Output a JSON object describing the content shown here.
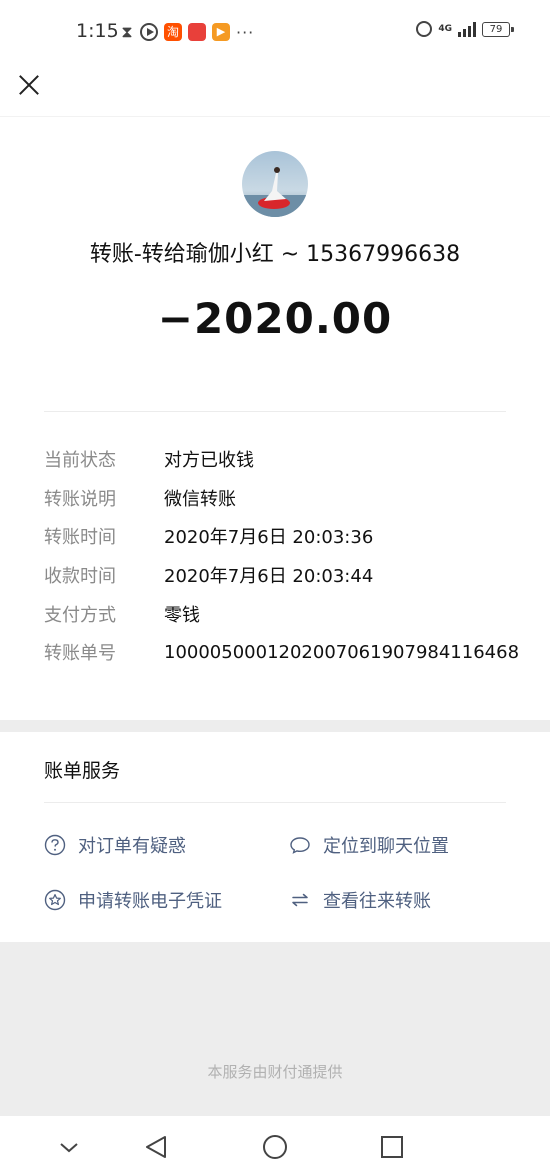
{
  "status_bar": {
    "time": "1:15",
    "tao_label": "淘",
    "network": "4G",
    "battery": "79",
    "more": "···"
  },
  "receipt": {
    "title": "转账-转给瑜伽小红 ~ 15367996638",
    "amount": "−2020.00",
    "details": [
      {
        "label": "当前状态",
        "value": "对方已收钱"
      },
      {
        "label": "转账说明",
        "value": "微信转账"
      },
      {
        "label": "转账时间",
        "value": "2020年7月6日 20:03:36"
      },
      {
        "label": "收款时间",
        "value": "2020年7月6日 20:03:44"
      },
      {
        "label": "支付方式",
        "value": "零钱"
      },
      {
        "label": "转账单号",
        "value": "1000050001202007061907984116468"
      }
    ]
  },
  "services": {
    "title": "账单服务",
    "items": [
      {
        "label": "对订单有疑惑",
        "icon": "question-icon"
      },
      {
        "label": "定位到聊天位置",
        "icon": "chat-bubble-icon"
      },
      {
        "label": "申请转账电子凭证",
        "icon": "star-badge-icon"
      },
      {
        "label": "查看往来转账",
        "icon": "swap-arrows-icon"
      }
    ]
  },
  "footer": {
    "text": "本服务由财付通提供"
  },
  "colors": {
    "link": "#4f6080",
    "label": "#8a8a8a",
    "footer_bg": "#ededed"
  }
}
